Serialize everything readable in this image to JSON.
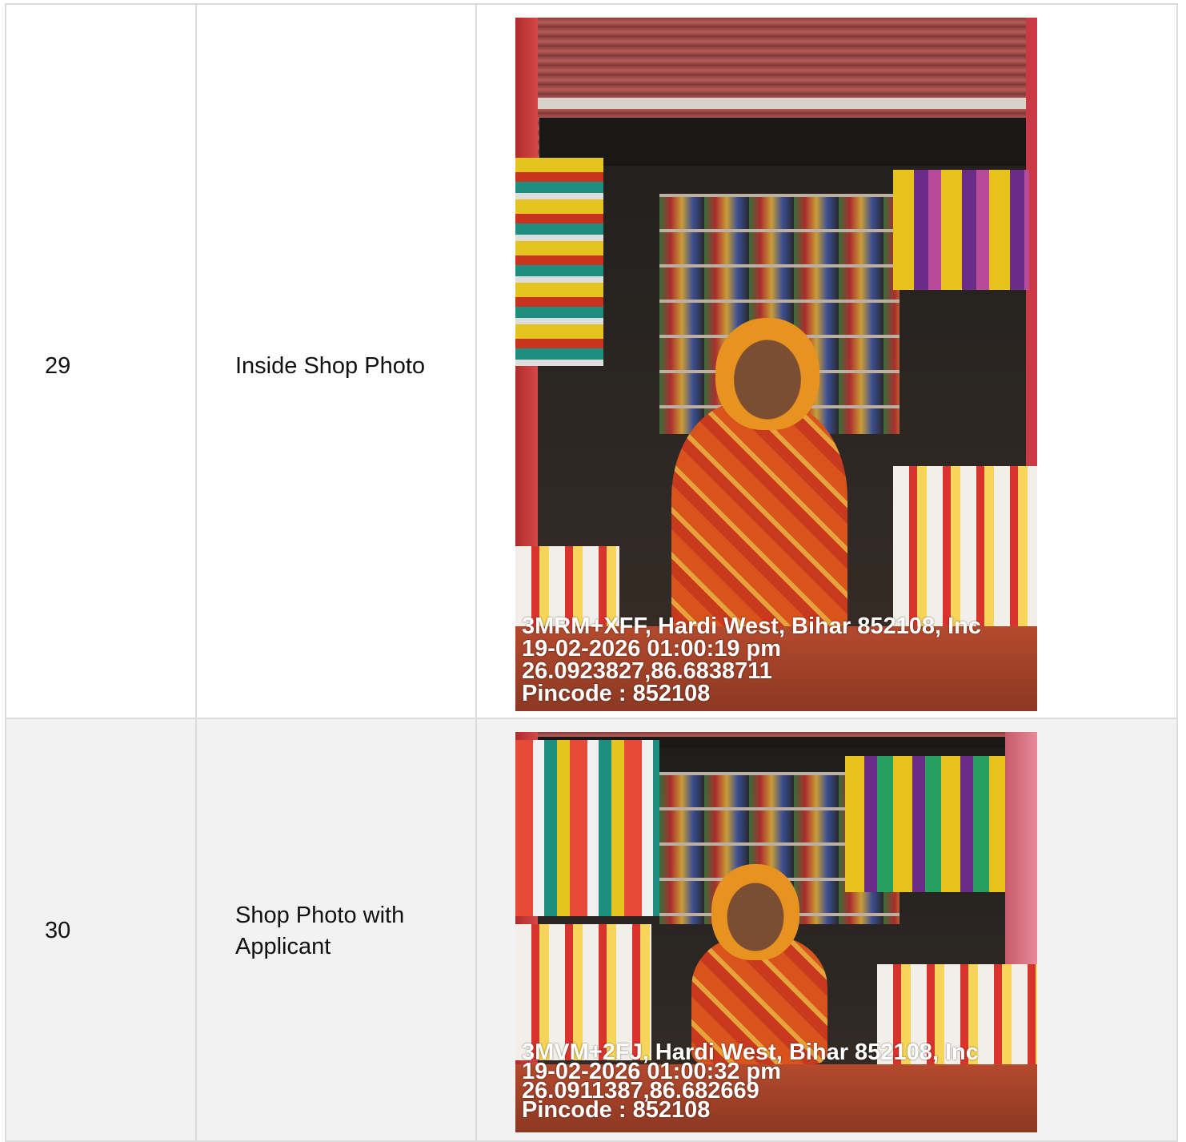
{
  "rows": [
    {
      "number": "29",
      "label": "Inside Shop Photo",
      "photo": {
        "address": "3MRM+XFF, Hardi West, Bihar 852108, Inc",
        "datetime": "19-02-2026 01:00:19 pm",
        "coords": "26.0923827,86.6838711",
        "pincode": "Pincode : 852108"
      }
    },
    {
      "number": "30",
      "label": "Shop Photo with Applicant",
      "photo": {
        "address": "3MVM+2FJ, Hardi West, Bihar 852108, Inc",
        "datetime": "19-02-2026 01:00:32 pm",
        "coords": "26.0911387,86.682669",
        "pincode": "Pincode : 852108"
      }
    }
  ]
}
